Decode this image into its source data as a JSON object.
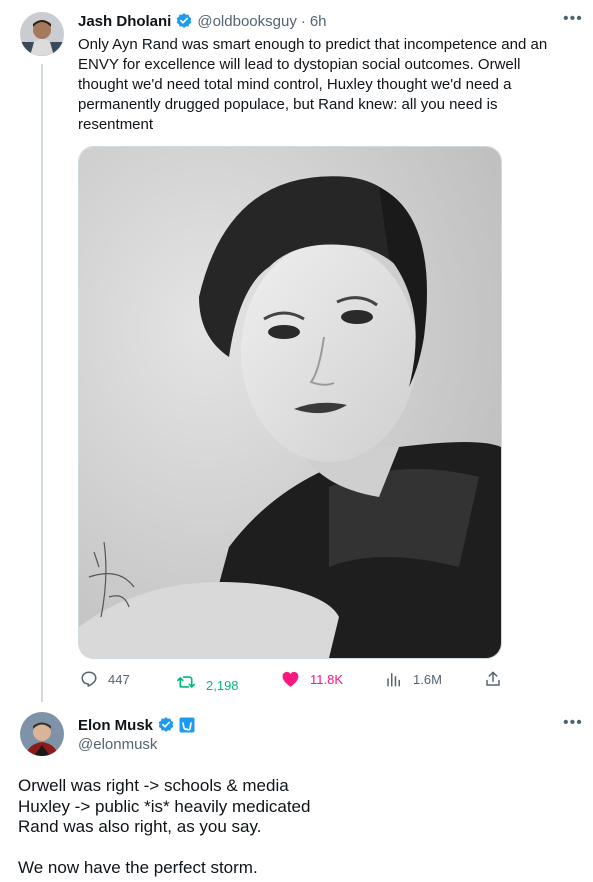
{
  "tweet": {
    "author_name": "Jash Dholani",
    "handle": "@oldbooksguy",
    "separator": "·",
    "time": "6h",
    "text": "Only Ayn Rand was smart enough to predict that incompetence and an ENVY for excellence will lead to dystopian social outcomes. Orwell thought we'd need total mind control, Huxley thought we'd need a permanently drugged populace, but Rand knew: all you need is resentment",
    "verified": true,
    "image_icon": "portrait-photo",
    "metrics": {
      "replies": "447",
      "retweets": "2,198",
      "likes": "11.8K",
      "views": "1.6M"
    },
    "colors": {
      "retweet": "#00ba7c",
      "like": "#f91880",
      "verified": "#1d9bf0"
    }
  },
  "reply": {
    "author_name": "Elon Musk",
    "handle": "@elonmusk",
    "verified": true,
    "affiliate_badge": true,
    "lines": [
      "Orwell was right -> schools & media",
      "Huxley -> public *is* heavily medicated",
      "Rand was also right, as you say.",
      "",
      "We now have the perfect storm."
    ]
  },
  "icons": [
    "more-icon",
    "reply-icon",
    "retweet-icon",
    "like-icon",
    "views-icon",
    "share-icon",
    "verified-icon"
  ]
}
